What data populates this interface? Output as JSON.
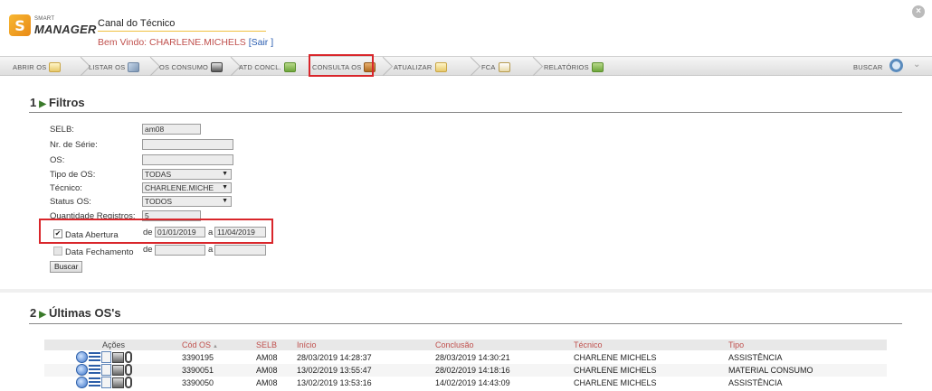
{
  "header": {
    "logo_small": "SMART",
    "logo_big": "MANAGER",
    "app_title": "Canal do Técnico",
    "welcome_text": "Bem Vindo: CHARLENE.MICHELS",
    "logout_open": "[",
    "logout_label": "Sair",
    "logout_close": "]"
  },
  "nav": {
    "items": [
      "ABRIR OS",
      "LISTAR OS",
      "OS CONSUMO",
      "ATD CONCL.",
      "CONSULTA OS",
      "ATUALIZAR",
      "FCA",
      "RELATÓRIOS"
    ],
    "active": "CONSULTA OS",
    "search_label": "BUSCAR"
  },
  "filtros": {
    "section_num": "1",
    "section_title": "Filtros",
    "selb_label": "SELB:",
    "selb_value": "am08",
    "serie_label": "Nr. de Série:",
    "serie_value": "",
    "os_label": "OS:",
    "os_value": "",
    "tipo_label": "Tipo de OS:",
    "tipo_value": "TODAS",
    "tecnico_label": "Técnico:",
    "tecnico_value": "CHARLENE.MICHE",
    "status_label": "Status OS:",
    "status_value": "TODOS",
    "qtd_label": "Quantidade Registros:",
    "qtd_value": "5",
    "abertura_label": "Data Abertura",
    "abertura_checked": true,
    "de_label": "de",
    "a_label": "a",
    "abertura_de": "01/01/2019",
    "abertura_a": "11/04/2019",
    "fechamento_label": "Data Fechamento",
    "fechamento_checked": false,
    "fechamento_de": "",
    "fechamento_a": "",
    "buscar_label": "Buscar"
  },
  "ultimas": {
    "section_num": "2",
    "section_title": "Últimas OS's",
    "columns": [
      "Ações",
      "Cód OS",
      "SELB",
      "Início",
      "Conclusão",
      "Técnico",
      "Tipo"
    ],
    "rows": [
      {
        "cod": "3390195",
        "selb": "AM08",
        "inicio": "28/03/2019 14:28:37",
        "conclusao": "28/03/2019 14:30:21",
        "tecnico": "CHARLENE MICHELS",
        "tipo": "ASSISTÊNCIA"
      },
      {
        "cod": "3390051",
        "selb": "AM08",
        "inicio": "13/02/2019 13:55:47",
        "conclusao": "28/02/2019 14:18:16",
        "tecnico": "CHARLENE MICHELS",
        "tipo": "MATERIAL CONSUMO"
      },
      {
        "cod": "3390050",
        "selb": "AM08",
        "inicio": "13/02/2019 13:53:16",
        "conclusao": "14/02/2019 14:43:09",
        "tecnico": "CHARLENE MICHELS",
        "tipo": "ASSISTÊNCIA"
      }
    ]
  }
}
